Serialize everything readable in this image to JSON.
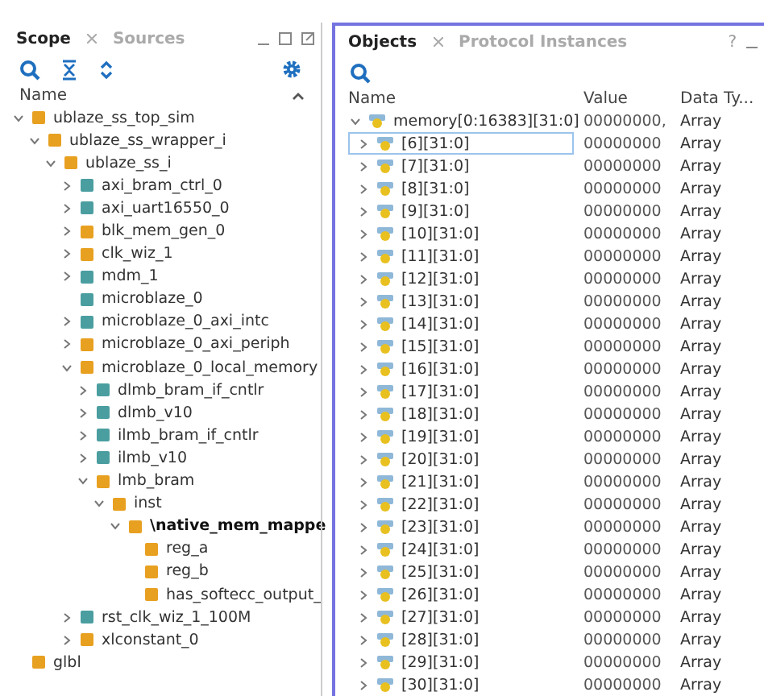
{
  "scope_panel": {
    "tabs": [
      {
        "label": "Scope",
        "selected": true
      },
      {
        "label": "Sources",
        "selected": false
      }
    ],
    "column": "Name",
    "tree": [
      {
        "name": "ublaze_ss_top_sim",
        "color": "#e8a020",
        "expanded": true,
        "children": [
          {
            "name": "ublaze_ss_wrapper_i",
            "color": "#e8a020",
            "expanded": true,
            "children": [
              {
                "name": "ublaze_ss_i",
                "color": "#e8a020",
                "expanded": true,
                "children": [
                  {
                    "name": "axi_bram_ctrl_0",
                    "color": "#4a9ea0",
                    "expanded": false
                  },
                  {
                    "name": "axi_uart16550_0",
                    "color": "#4a9ea0",
                    "expanded": false
                  },
                  {
                    "name": "blk_mem_gen_0",
                    "color": "#e8a020",
                    "expanded": false
                  },
                  {
                    "name": "clk_wiz_1",
                    "color": "#e8a020",
                    "expanded": false
                  },
                  {
                    "name": "mdm_1",
                    "color": "#4a9ea0",
                    "expanded": false
                  },
                  {
                    "name": "microblaze_0",
                    "color": "#4a9ea0"
                  },
                  {
                    "name": "microblaze_0_axi_intc",
                    "color": "#4a9ea0",
                    "expanded": false
                  },
                  {
                    "name": "microblaze_0_axi_periph",
                    "color": "#e8a020",
                    "expanded": false
                  },
                  {
                    "name": "microblaze_0_local_memory",
                    "color": "#e8a020",
                    "expanded": true,
                    "children": [
                      {
                        "name": "dlmb_bram_if_cntlr",
                        "color": "#4a9ea0",
                        "expanded": false
                      },
                      {
                        "name": "dlmb_v10",
                        "color": "#4a9ea0",
                        "expanded": false
                      },
                      {
                        "name": "ilmb_bram_if_cntlr",
                        "color": "#4a9ea0",
                        "expanded": false
                      },
                      {
                        "name": "ilmb_v10",
                        "color": "#4a9ea0",
                        "expanded": false
                      },
                      {
                        "name": "lmb_bram",
                        "color": "#e8a020",
                        "expanded": true,
                        "children": [
                          {
                            "name": "inst",
                            "color": "#e8a020",
                            "expanded": true,
                            "children": [
                              {
                                "name": "\\native_mem_mappe",
                                "color": "#e8a020",
                                "expanded": true,
                                "bold": true,
                                "children": [
                                  {
                                    "name": "reg_a",
                                    "color": "#e8a020"
                                  },
                                  {
                                    "name": "reg_b",
                                    "color": "#e8a020"
                                  },
                                  {
                                    "name": "has_softecc_output_",
                                    "color": "#e8a020"
                                  }
                                ]
                              }
                            ]
                          }
                        ]
                      }
                    ]
                  },
                  {
                    "name": "rst_clk_wiz_1_100M",
                    "color": "#4a9ea0",
                    "expanded": false
                  },
                  {
                    "name": "xlconstant_0",
                    "color": "#e8a020",
                    "expanded": false
                  }
                ]
              }
            ]
          }
        ]
      },
      {
        "name": "glbl",
        "color": "#e8a020"
      }
    ]
  },
  "objects_panel": {
    "tabs": [
      {
        "label": "Objects",
        "selected": true
      },
      {
        "label": "Protocol Instances",
        "selected": false
      }
    ],
    "help": "?",
    "columns": [
      "Name",
      "Value",
      "Data Ty..."
    ],
    "rows": [
      {
        "name": "memory[0:16383][31:0]",
        "value": "00000000,",
        "type": "Array",
        "expanded": true,
        "selected": false,
        "child": false
      },
      {
        "name": "[6][31:0]",
        "value": "00000000",
        "type": "Array",
        "expanded": false,
        "selected": true,
        "child": true
      },
      {
        "name": "[7][31:0]",
        "value": "00000000",
        "type": "Array",
        "expanded": false,
        "selected": false,
        "child": true
      },
      {
        "name": "[8][31:0]",
        "value": "00000000",
        "type": "Array",
        "expanded": false,
        "selected": false,
        "child": true
      },
      {
        "name": "[9][31:0]",
        "value": "00000000",
        "type": "Array",
        "expanded": false,
        "selected": false,
        "child": true
      },
      {
        "name": "[10][31:0]",
        "value": "00000000",
        "type": "Array",
        "expanded": false,
        "selected": false,
        "child": true
      },
      {
        "name": "[11][31:0]",
        "value": "00000000",
        "type": "Array",
        "expanded": false,
        "selected": false,
        "child": true
      },
      {
        "name": "[12][31:0]",
        "value": "00000000",
        "type": "Array",
        "expanded": false,
        "selected": false,
        "child": true
      },
      {
        "name": "[13][31:0]",
        "value": "00000000",
        "type": "Array",
        "expanded": false,
        "selected": false,
        "child": true
      },
      {
        "name": "[14][31:0]",
        "value": "00000000",
        "type": "Array",
        "expanded": false,
        "selected": false,
        "child": true
      },
      {
        "name": "[15][31:0]",
        "value": "00000000",
        "type": "Array",
        "expanded": false,
        "selected": false,
        "child": true
      },
      {
        "name": "[16][31:0]",
        "value": "00000000",
        "type": "Array",
        "expanded": false,
        "selected": false,
        "child": true
      },
      {
        "name": "[17][31:0]",
        "value": "00000000",
        "type": "Array",
        "expanded": false,
        "selected": false,
        "child": true
      },
      {
        "name": "[18][31:0]",
        "value": "00000000",
        "type": "Array",
        "expanded": false,
        "selected": false,
        "child": true
      },
      {
        "name": "[19][31:0]",
        "value": "00000000",
        "type": "Array",
        "expanded": false,
        "selected": false,
        "child": true
      },
      {
        "name": "[20][31:0]",
        "value": "00000000",
        "type": "Array",
        "expanded": false,
        "selected": false,
        "child": true
      },
      {
        "name": "[21][31:0]",
        "value": "00000000",
        "type": "Array",
        "expanded": false,
        "selected": false,
        "child": true
      },
      {
        "name": "[22][31:0]",
        "value": "00000000",
        "type": "Array",
        "expanded": false,
        "selected": false,
        "child": true
      },
      {
        "name": "[23][31:0]",
        "value": "00000000",
        "type": "Array",
        "expanded": false,
        "selected": false,
        "child": true
      },
      {
        "name": "[24][31:0]",
        "value": "00000000",
        "type": "Array",
        "expanded": false,
        "selected": false,
        "child": true
      },
      {
        "name": "[25][31:0]",
        "value": "00000000",
        "type": "Array",
        "expanded": false,
        "selected": false,
        "child": true
      },
      {
        "name": "[26][31:0]",
        "value": "00000000",
        "type": "Array",
        "expanded": false,
        "selected": false,
        "child": true
      },
      {
        "name": "[27][31:0]",
        "value": "00000000",
        "type": "Array",
        "expanded": false,
        "selected": false,
        "child": true
      },
      {
        "name": "[28][31:0]",
        "value": "00000000",
        "type": "Array",
        "expanded": false,
        "selected": false,
        "child": true
      },
      {
        "name": "[29][31:0]",
        "value": "00000000",
        "type": "Array",
        "expanded": false,
        "selected": false,
        "child": true
      },
      {
        "name": "[30][31:0]",
        "value": "00000000",
        "type": "Array",
        "expanded": false,
        "selected": false,
        "child": true
      }
    ]
  }
}
